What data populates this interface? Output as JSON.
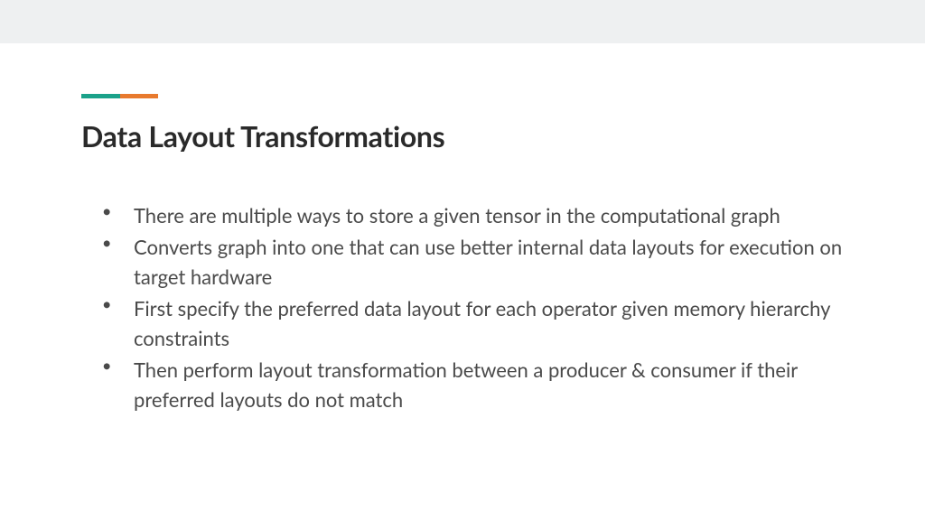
{
  "slide": {
    "title": "Data Layout Transformations",
    "bullets": [
      "There are multiple ways to store a given tensor in the computational graph",
      "Converts graph into one that can use better internal data layouts for execution on target hardware",
      "First specify the preferred data layout for each operator given memory hierarchy constraints",
      "Then perform layout transformation between a producer & consumer if their preferred layouts do not match"
    ]
  }
}
